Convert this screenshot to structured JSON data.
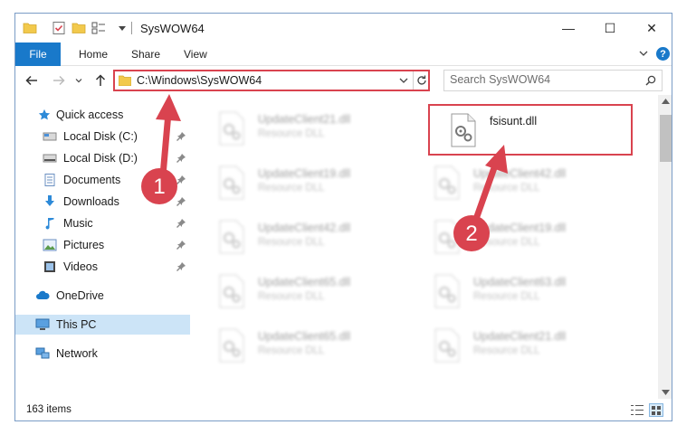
{
  "window": {
    "title": "SysWOW64",
    "controls": {
      "minimize": "—",
      "maximize": "☐",
      "close": "✕"
    }
  },
  "ribbon": {
    "tabs": [
      {
        "label": "File",
        "active": true
      },
      {
        "label": "Home"
      },
      {
        "label": "Share"
      },
      {
        "label": "View"
      }
    ],
    "help": "?"
  },
  "address": {
    "path": "C:\\Windows\\SysWOW64",
    "search_placeholder": "Search SysWOW64"
  },
  "navigation": {
    "quick_access": "Quick access",
    "items": [
      {
        "label": "Local Disk (C:)",
        "icon": "drive-icon",
        "pinned": true
      },
      {
        "label": "Local Disk (D:)",
        "icon": "drive-icon",
        "pinned": true
      },
      {
        "label": "Documents",
        "icon": "documents-icon",
        "pinned": true
      },
      {
        "label": "Downloads",
        "icon": "downloads-icon",
        "pinned": true
      },
      {
        "label": "Music",
        "icon": "music-icon",
        "pinned": true
      },
      {
        "label": "Pictures",
        "icon": "pictures-icon",
        "pinned": true
      },
      {
        "label": "Videos",
        "icon": "videos-icon",
        "pinned": true
      }
    ],
    "onedrive": "OneDrive",
    "this_pc": "This PC",
    "network": "Network"
  },
  "files": [
    {
      "name": "UpdateClient21.dll",
      "type": "Resource DLL",
      "blurred": true
    },
    {
      "name": "fsisunt.dll",
      "type": "",
      "blurred": false,
      "highlighted": true
    },
    {
      "name": "UpdateClient19.dll",
      "type": "Resource DLL",
      "blurred": true
    },
    {
      "name": "UpdateClient42.dll",
      "type": "Resource DLL",
      "blurred": true
    },
    {
      "name": "UpdateClient42.dll",
      "type": "Resource DLL",
      "blurred": true
    },
    {
      "name": "UpdateClient19.dll",
      "type": "Resource DLL",
      "blurred": true
    },
    {
      "name": "UpdateClient65.dll",
      "type": "Resource DLL",
      "blurred": true
    },
    {
      "name": "UpdateClient63.dll",
      "type": "Resource DLL",
      "blurred": true
    },
    {
      "name": "UpdateClient65.dll",
      "type": "Resource DLL",
      "blurred": true
    },
    {
      "name": "UpdateClient21.dll",
      "type": "Resource DLL",
      "blurred": true
    }
  ],
  "status": {
    "item_count": "163 items"
  },
  "annotations": {
    "color": "#d9434f",
    "badge_1": "1",
    "badge_2": "2"
  }
}
